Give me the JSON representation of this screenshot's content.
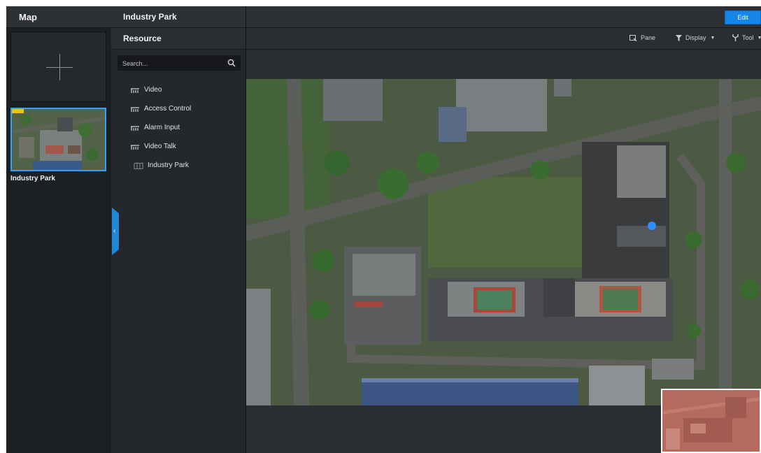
{
  "map_panel": {
    "title": "Map",
    "thumbnail_label": "Industry Park"
  },
  "resource_panel": {
    "header": "Industry Park",
    "section_title": "Resource",
    "search_placeholder": "Search...",
    "items": [
      {
        "label": "Video",
        "icon": "device-tree-icon"
      },
      {
        "label": "Access Control",
        "icon": "device-tree-icon"
      },
      {
        "label": "Alarm Input",
        "icon": "device-tree-icon"
      },
      {
        "label": "Video Talk",
        "icon": "device-tree-icon"
      },
      {
        "label": "Industry Park",
        "icon": "map-icon"
      }
    ]
  },
  "toolbar": {
    "edit_label": "Edit",
    "pane_label": "Pane",
    "display_label": "Display",
    "tool_label": "Tool"
  },
  "colors": {
    "accent": "#1486e8",
    "selection_border": "#2fa3ff",
    "marker": "#2f8cff",
    "flag": "#f4c20d"
  }
}
